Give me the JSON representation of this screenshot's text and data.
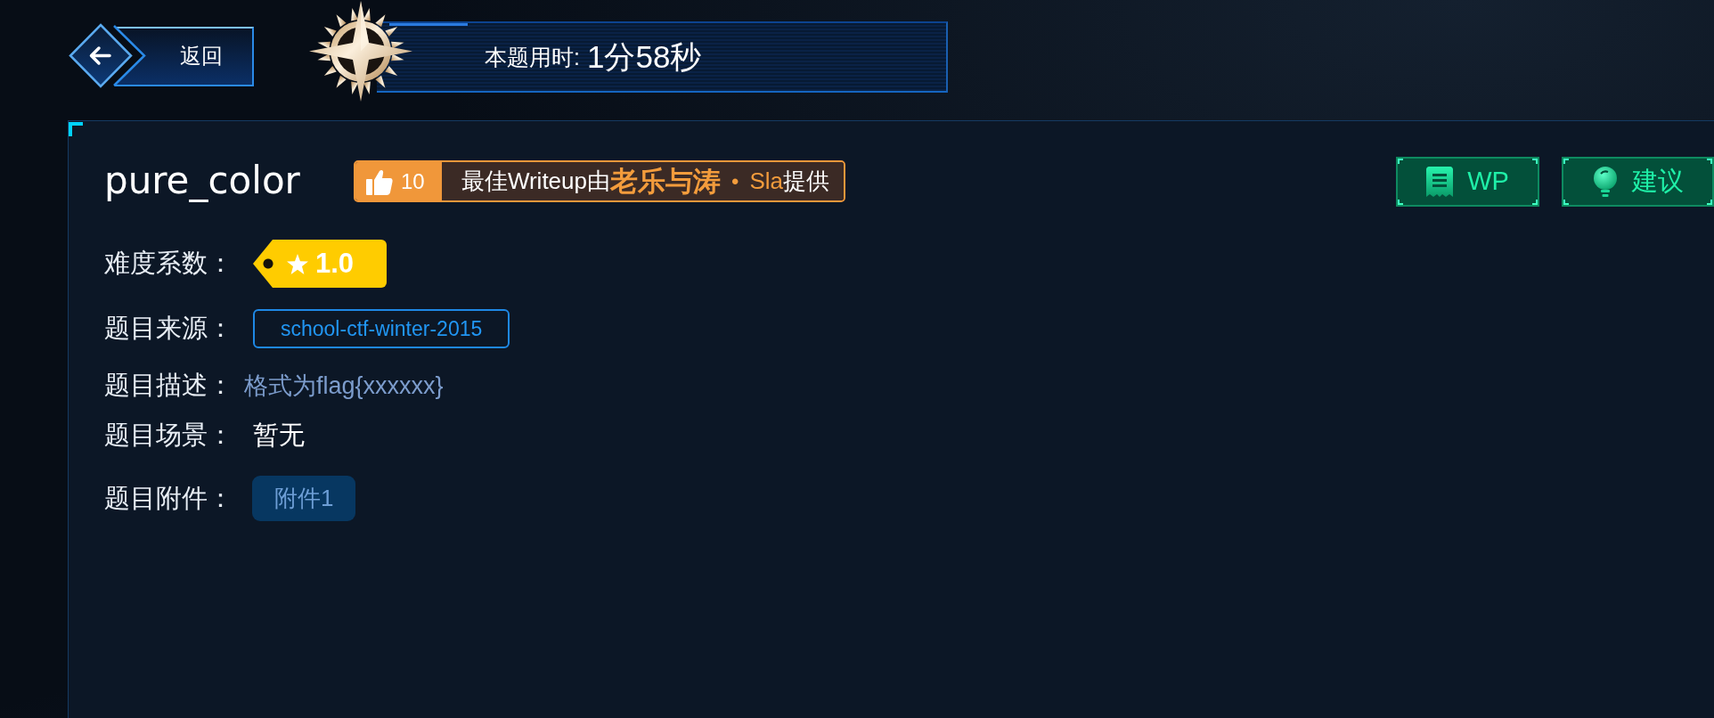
{
  "back_button": {
    "label": "返回"
  },
  "timer": {
    "label": "本题用时:",
    "value": "1分58秒"
  },
  "challenge": {
    "title": "pure_color",
    "likes": "10",
    "credit": [
      {
        "kind": "plain",
        "text": "最佳Writeup由"
      },
      {
        "kind": "author",
        "text": "老乐与涛"
      },
      {
        "kind": "separator",
        "text": "•"
      },
      {
        "kind": "team",
        "text": "Sla"
      },
      {
        "kind": "plain",
        "text": "提供"
      }
    ]
  },
  "actions": [
    {
      "kind": "writeup",
      "label": "WP"
    },
    {
      "kind": "suggestion",
      "label": "建议"
    }
  ],
  "fields": [
    {
      "kind": "rating",
      "label": "难度系数：",
      "value": "1.0"
    },
    {
      "kind": "tag",
      "label": "题目来源：",
      "value": "school-ctf-winter-2015"
    },
    {
      "kind": "description",
      "label": "题目描述：",
      "value": "格式为flag{xxxxxx}"
    },
    {
      "kind": "text",
      "label": "题目场景：",
      "value": "暂无"
    },
    {
      "kind": "attachments",
      "label": "题目附件：",
      "files": [
        "附件1"
      ]
    }
  ]
}
